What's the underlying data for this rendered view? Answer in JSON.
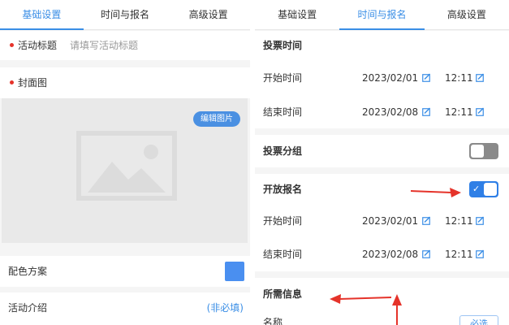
{
  "left": {
    "tabs": [
      {
        "label": "基础设置",
        "active": true
      },
      {
        "label": "时间与报名",
        "active": false
      },
      {
        "label": "高级设置",
        "active": false
      }
    ],
    "title_field": {
      "label": "活动标题",
      "placeholder": "请填写活动标题",
      "required": true
    },
    "cover": {
      "label": "封面图",
      "required": true,
      "edit_button": "编辑图片"
    },
    "color_scheme": {
      "label": "配色方案",
      "color": "#4a8ff0"
    },
    "intro": {
      "label": "活动介绍",
      "optional_text": "(非必填)"
    }
  },
  "right": {
    "tabs": [
      {
        "label": "基础设置",
        "active": false
      },
      {
        "label": "时间与报名",
        "active": true
      },
      {
        "label": "高级设置",
        "active": false
      }
    ],
    "vote_time": {
      "title": "投票时间",
      "start": {
        "label": "开始时间",
        "date": "2023/02/01",
        "time": "12:11"
      },
      "end": {
        "label": "结束时间",
        "date": "2023/02/08",
        "time": "12:11"
      }
    },
    "vote_group": {
      "label": "投票分组",
      "enabled": false
    },
    "signup": {
      "label": "开放报名",
      "enabled": true,
      "start": {
        "label": "开始时间",
        "date": "2023/02/01",
        "time": "12:11"
      },
      "end": {
        "label": "结束时间",
        "date": "2023/02/08",
        "time": "12:11"
      }
    },
    "required_info": {
      "title": "所需信息",
      "name_label": "名称",
      "name_button": "必选"
    }
  },
  "colors": {
    "accent": "#3a8ee6",
    "required_dot": "#e5332a",
    "arrow": "#e5332a",
    "toggle_on": "#2f7fe6",
    "toggle_off": "#8a8a8a"
  }
}
